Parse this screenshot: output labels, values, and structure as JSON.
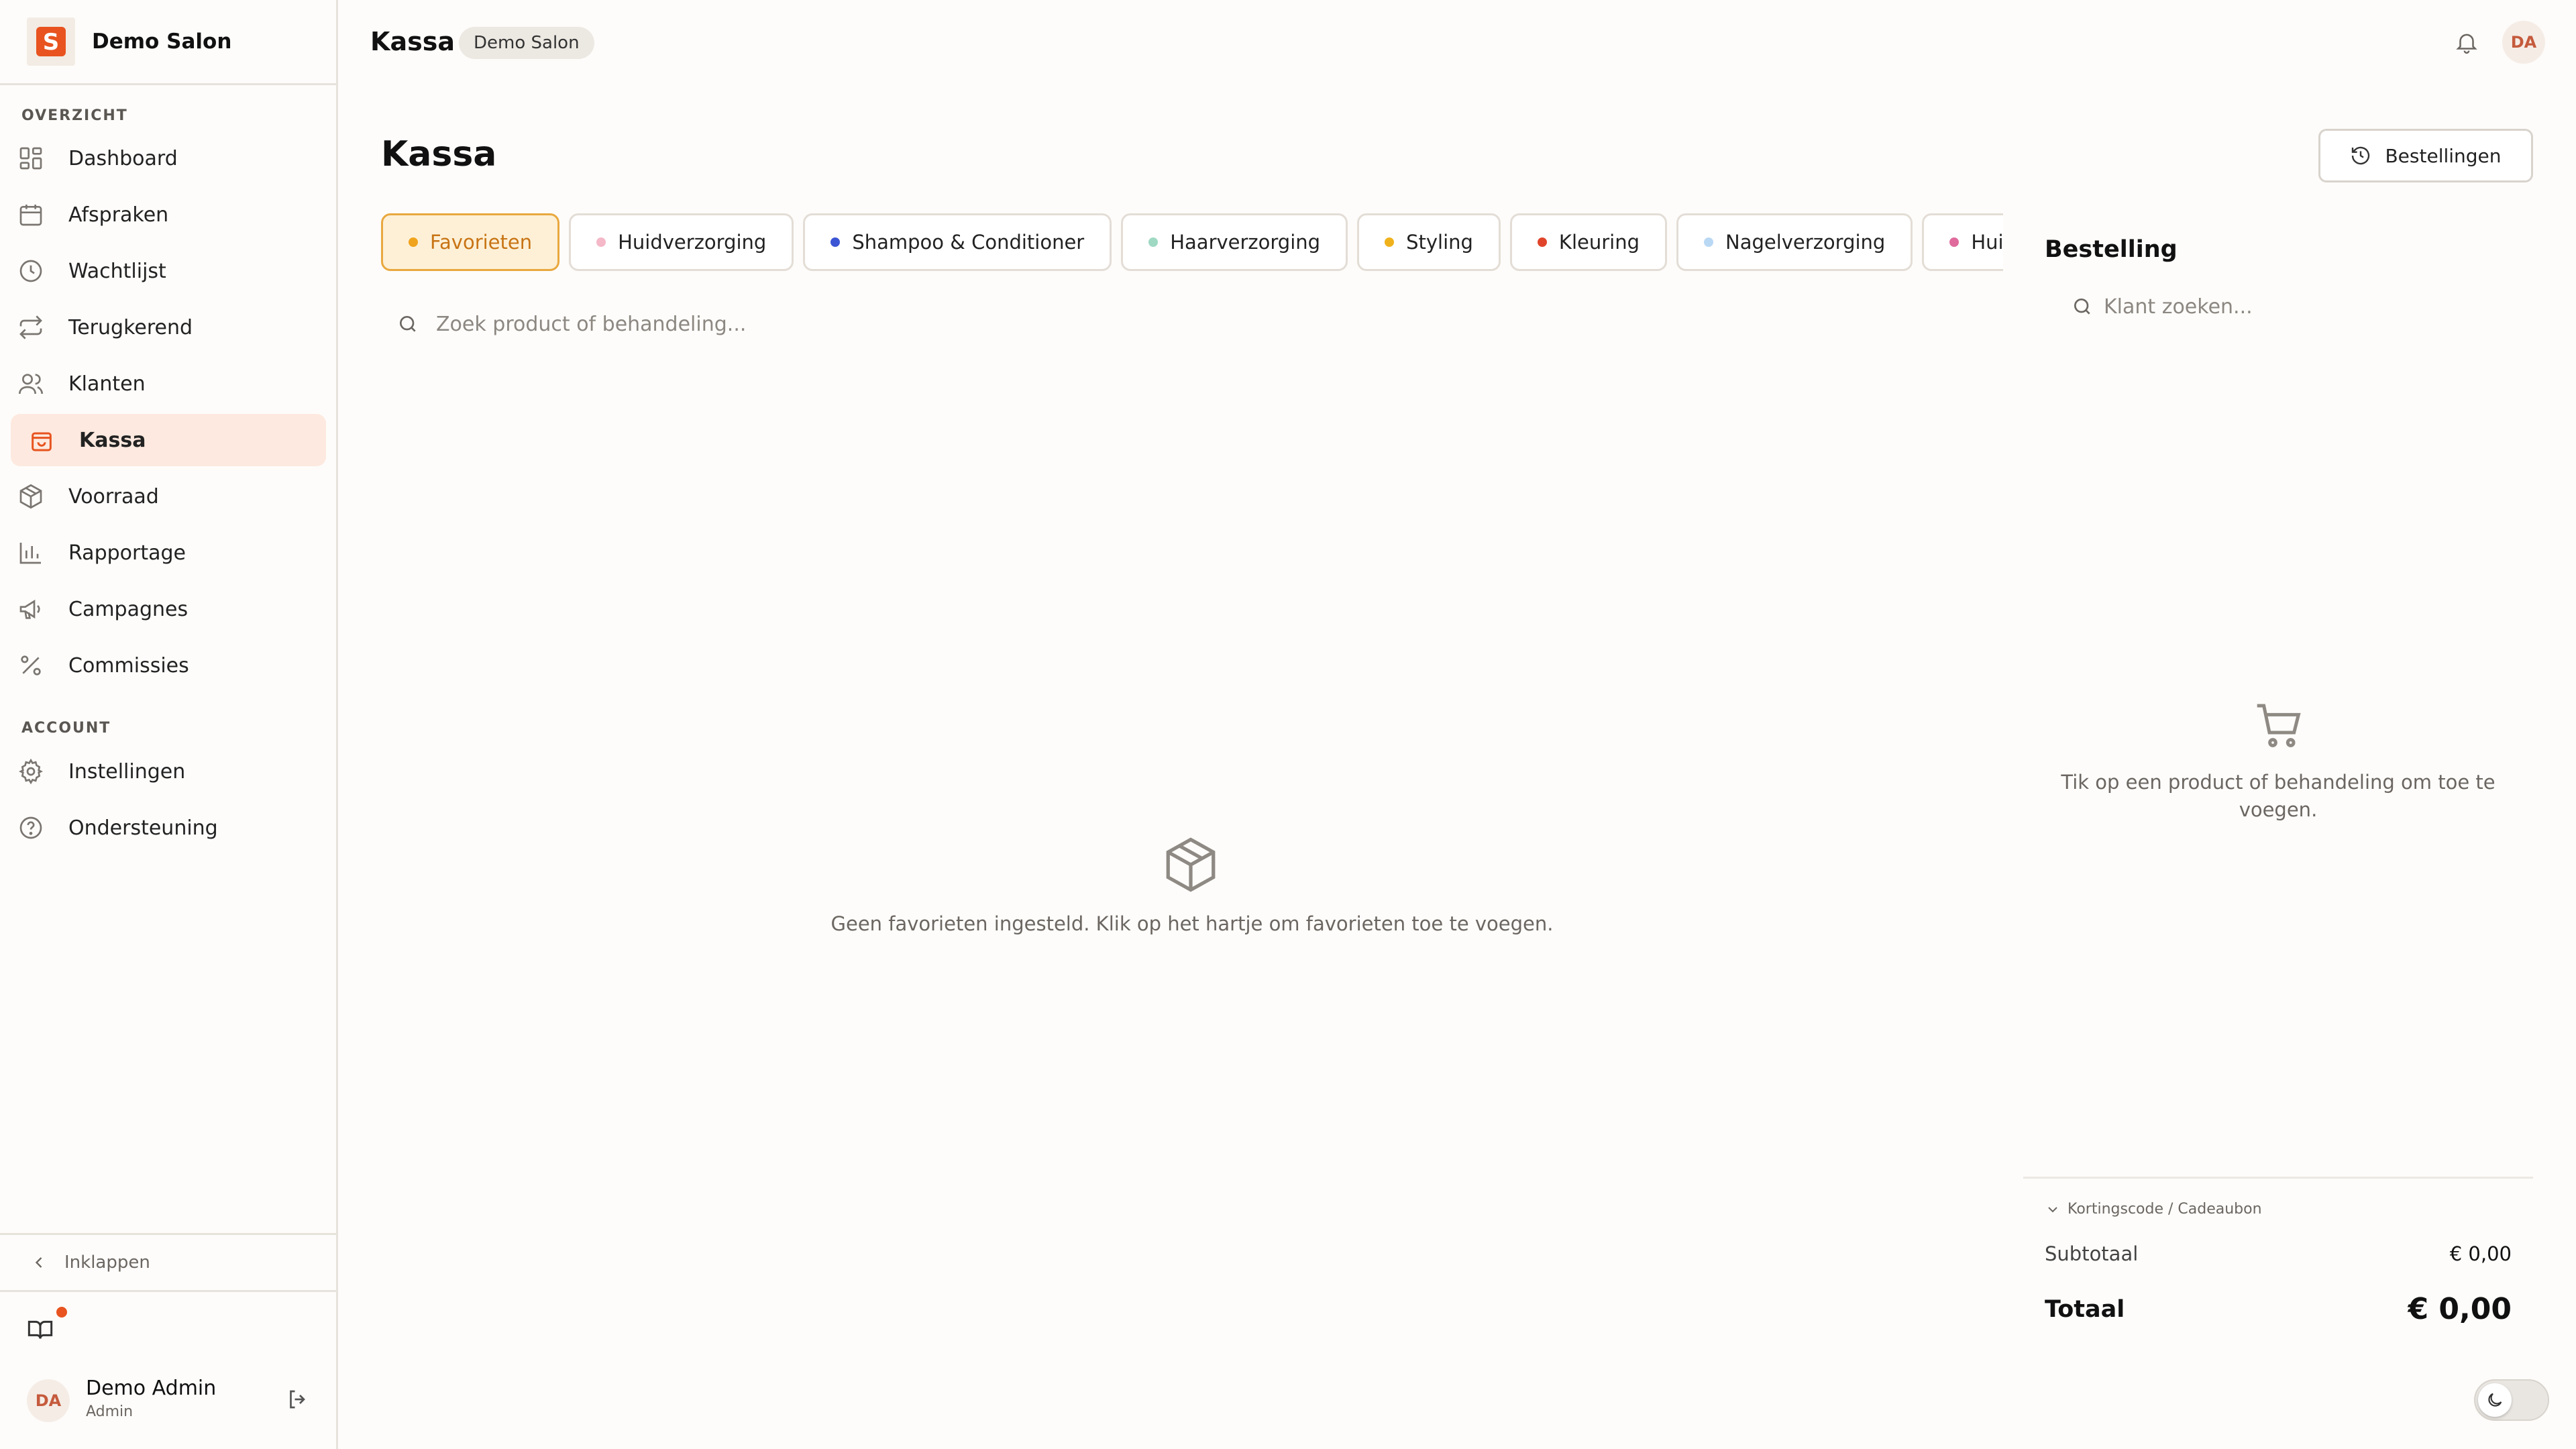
{
  "brand": {
    "logo_letter": "S",
    "name": "Demo Salon"
  },
  "sidebar": {
    "section_overview": "OVERZICHT",
    "section_account": "ACCOUNT",
    "items": [
      {
        "label": "Dashboard",
        "icon": "grid-icon"
      },
      {
        "label": "Afspraken",
        "icon": "calendar-icon"
      },
      {
        "label": "Wachtlijst",
        "icon": "clock-icon"
      },
      {
        "label": "Terugkerend",
        "icon": "repeat-icon"
      },
      {
        "label": "Klanten",
        "icon": "users-icon"
      },
      {
        "label": "Kassa",
        "icon": "shopping-bag-icon",
        "active": true
      },
      {
        "label": "Voorraad",
        "icon": "package-icon"
      },
      {
        "label": "Rapportage",
        "icon": "bar-chart-icon"
      },
      {
        "label": "Campagnes",
        "icon": "megaphone-icon"
      },
      {
        "label": "Commissies",
        "icon": "percent-icon"
      }
    ],
    "account_items": [
      {
        "label": "Instellingen",
        "icon": "gear-icon"
      },
      {
        "label": "Ondersteuning",
        "icon": "help-circle-icon"
      }
    ],
    "collapse_label": "Inklappen",
    "user": {
      "initials": "DA",
      "name": "Demo Admin",
      "role": "Admin"
    }
  },
  "topbar": {
    "title": "Kassa",
    "badge": "Demo Salon",
    "avatar_initials": "DA"
  },
  "main": {
    "title": "Kassa",
    "orders_button": "Bestellingen",
    "tabs": [
      {
        "label": "Favorieten",
        "dot_color": "#f0a31c",
        "active": true
      },
      {
        "label": "Huidverzorging",
        "dot_color": "#f4b8c8"
      },
      {
        "label": "Shampoo & Conditioner",
        "dot_color": "#3b55d4"
      },
      {
        "label": "Haarverzorging",
        "dot_color": "#9fd9c3"
      },
      {
        "label": "Styling",
        "dot_color": "#f0b21c"
      },
      {
        "label": "Kleuring",
        "dot_color": "#e0452b"
      },
      {
        "label": "Nagelverzorging",
        "dot_color": "#b9d8f4"
      },
      {
        "label": "Huidverzorging",
        "dot_color": "#e06a9c"
      }
    ],
    "search_placeholder": "Zoek product of behandeling...",
    "empty_text": "Geen favorieten ingesteld. Klik op het hartje om favorieten toe te voegen."
  },
  "order": {
    "title": "Bestelling",
    "client_search_placeholder": "Klant zoeken...",
    "empty_text": "Tik op een product of behandeling om toe te voegen.",
    "discount_label": "Kortingscode / Cadeaubon",
    "subtotal_label": "Subtotaal",
    "subtotal_value": "€ 0,00",
    "total_label": "Totaal",
    "total_value": "€ 0,00"
  },
  "colors": {
    "accent": "#e8531f",
    "tab_active_bg": "#fdf0d7",
    "tab_active_border": "#e9a83f"
  }
}
